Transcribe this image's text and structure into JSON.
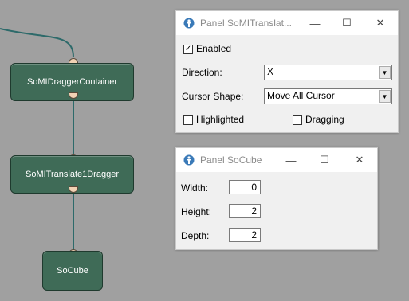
{
  "graph": {
    "nodes": [
      {
        "label": "SoMIDraggerContainer"
      },
      {
        "label": "SoMITranslate1Dragger"
      },
      {
        "label": "SoCube"
      }
    ]
  },
  "panel_translate": {
    "title": "Panel SoMITranslat...",
    "enabled_label": "Enabled",
    "enabled_checked": true,
    "direction_label": "Direction:",
    "direction_value": "X",
    "cursor_label": "Cursor Shape:",
    "cursor_value": "Move All Cursor",
    "highlighted_label": "Highlighted",
    "dragging_label": "Dragging"
  },
  "panel_cube": {
    "title": "Panel SoCube",
    "width_label": "Width:",
    "width_value": "0",
    "height_label": "Height:",
    "height_value": "2",
    "depth_label": "Depth:",
    "depth_value": "2"
  },
  "window_controls": {
    "minimize": "—",
    "maximize": "☐",
    "close": "✕"
  },
  "icons": {
    "node_port": "connector-port-icon",
    "app": "app-logo-icon"
  },
  "colors": {
    "background": "#a0a0a0",
    "node": "#3f6b57",
    "wire": "#2d6a6a",
    "port": "#f1d2b4"
  }
}
